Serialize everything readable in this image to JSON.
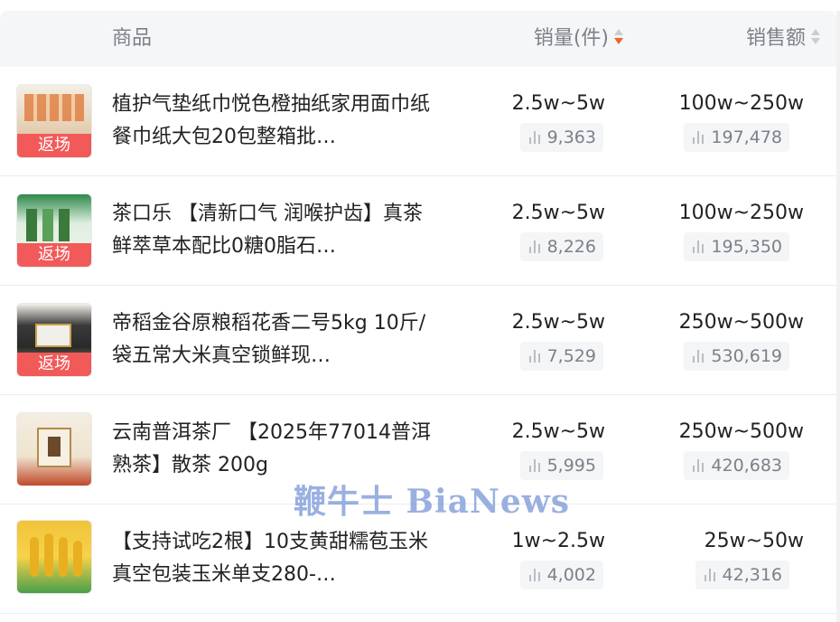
{
  "header": {
    "product_label": "商品",
    "sales_label": "销量(件)",
    "revenue_label": "销售额",
    "sort_icon": "sort-arrows-icon",
    "active_sort_color": "#f2612d"
  },
  "rows": [
    {
      "title": "植护气垫纸巾悦色橙抽纸家用面巾纸餐巾纸大包20包整箱批…",
      "tag": "返场",
      "sales_range": "2.5w~5w",
      "sales_count": "9,363",
      "revenue_range": "100w~250w",
      "revenue_count": "197,478"
    },
    {
      "title": "茶口乐 【清新口气 润喉护齿】真茶鲜萃草本配比0糖0脂石…",
      "tag": "返场",
      "sales_range": "2.5w~5w",
      "sales_count": "8,226",
      "revenue_range": "100w~250w",
      "revenue_count": "195,350"
    },
    {
      "title": "帝稻金谷原粮稻花香二号5kg 10斤/袋五常大米真空锁鲜现…",
      "tag": "返场",
      "sales_range": "2.5w~5w",
      "sales_count": "7,529",
      "revenue_range": "250w~500w",
      "revenue_count": "530,619"
    },
    {
      "title": "云南普洱茶厂 【2025年77014普洱熟茶】散茶 200g",
      "tag": "",
      "sales_range": "2.5w~5w",
      "sales_count": "5,995",
      "revenue_range": "250w~500w",
      "revenue_count": "420,683"
    },
    {
      "title": "【支持试吃2根】10支黄甜糯苞玉米真空包装玉米单支280-…",
      "tag": "",
      "sales_range": "1w~2.5w",
      "sales_count": "4,002",
      "revenue_range": "25w~50w",
      "revenue_count": "42,316"
    }
  ],
  "watermark": "鞭牛士 BiaNews"
}
